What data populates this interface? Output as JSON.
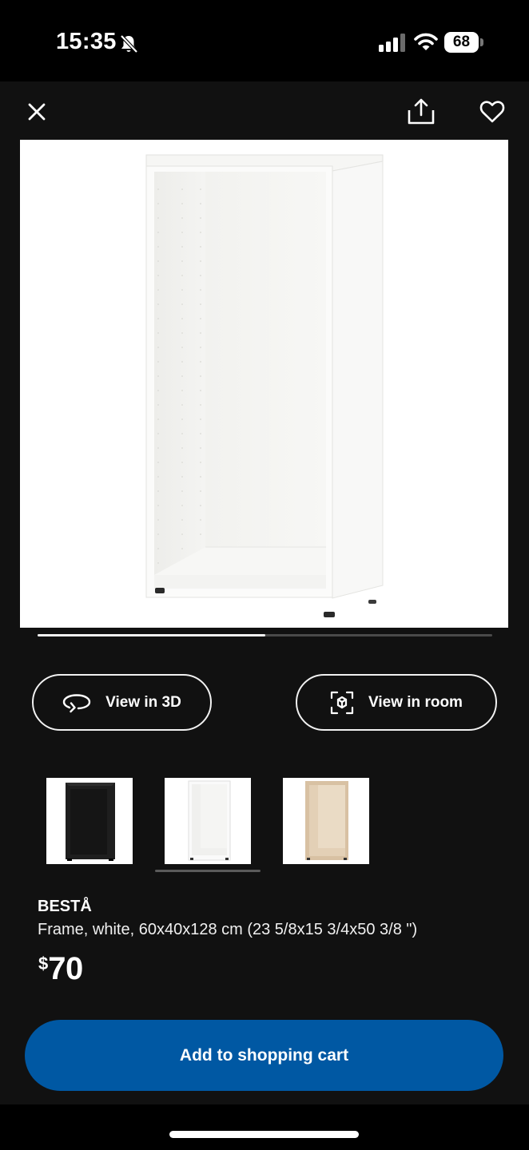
{
  "status_bar": {
    "time": "15:35",
    "battery": "68",
    "icons": [
      "bell-muted-icon",
      "signal-icon",
      "wifi-icon",
      "battery-icon"
    ]
  },
  "toolbar": {
    "icons": [
      "close-icon",
      "share-icon",
      "heart-icon"
    ]
  },
  "gallery": {
    "progress": 0.5
  },
  "actions": {
    "view_3d_label": "View in 3D",
    "view_room_label": "View in room"
  },
  "variants": [
    {
      "name": "black",
      "color": "#1e1e1e",
      "selected": false
    },
    {
      "name": "white",
      "color": "#ffffff",
      "selected": true
    },
    {
      "name": "white stained oak",
      "color": "#d8c1a3",
      "selected": false
    }
  ],
  "product": {
    "name": "BESTÅ",
    "description": "Frame, white, 60x40x128 cm (23 5/8x15 3/4x50 3/8 \")",
    "price_currency": "$",
    "price_value": "70"
  },
  "cart": {
    "add_label": "Add to shopping cart"
  },
  "colors": {
    "background": "#111111",
    "accent": "#0058a3",
    "text": "#ffffff"
  }
}
